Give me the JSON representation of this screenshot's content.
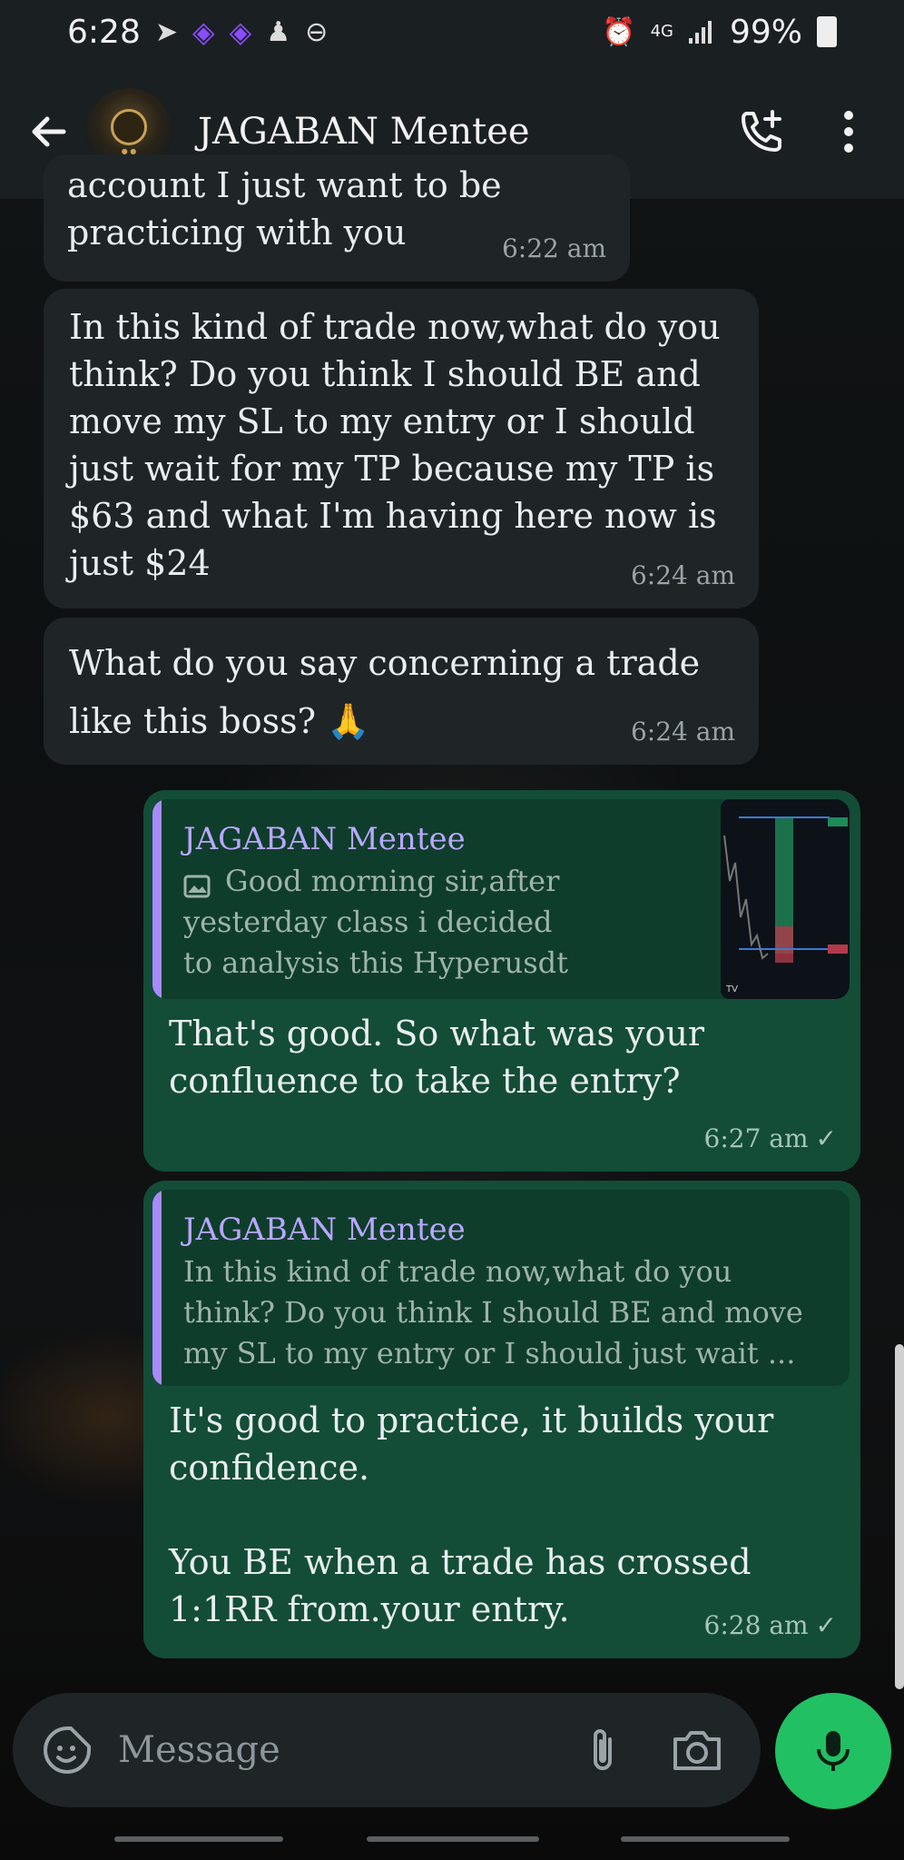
{
  "status_bar": {
    "time": "6:28",
    "network": "4G",
    "battery": "99%"
  },
  "header": {
    "contact_name": "JAGABAN Mentee"
  },
  "messages": [
    {
      "direction": "in",
      "text": "account I just want to be\npracticing with you",
      "time": "6:22 am"
    },
    {
      "direction": "in",
      "text": "In this kind of trade now,what do you think? Do you think I should BE and move my SL to my entry or I should just wait for my TP because my TP is $63 and what I'm having here now is just $24",
      "time": "6:24 am"
    },
    {
      "direction": "in",
      "text": "What do you say concerning a trade like this boss? 🙏",
      "time": "6:24 am"
    },
    {
      "direction": "out",
      "quote_author": "JAGABAN Mentee",
      "quote_text": "Good morning sir,after yesterday class i decided to analysis this Hyperusdt",
      "text": "That's good. So what was your confluence to take the entry?",
      "time": "6:27 am"
    },
    {
      "direction": "out",
      "quote_author": "JAGABAN Mentee",
      "quote_text": "In this kind of trade now,what do you think? Do you think I should BE and move my SL to my entry or I should just wait ...",
      "text": "It's good to practice, it builds your confidence.\n\nYou BE when a trade has crossed 1:1RR from.your entry.",
      "time": "6:28 am"
    }
  ],
  "composer": {
    "placeholder": "Message"
  },
  "colors": {
    "incoming_bubble": "#1f2427",
    "outgoing_bubble": "#134d37",
    "accent_green": "#21c063",
    "quote_bar": "#a78bfa"
  },
  "icons": [
    "back-arrow-icon",
    "add-call-icon",
    "more-vert-icon",
    "sticker-icon",
    "attach-icon",
    "camera-icon",
    "mic-icon",
    "image-icon",
    "double-check-icon"
  ]
}
